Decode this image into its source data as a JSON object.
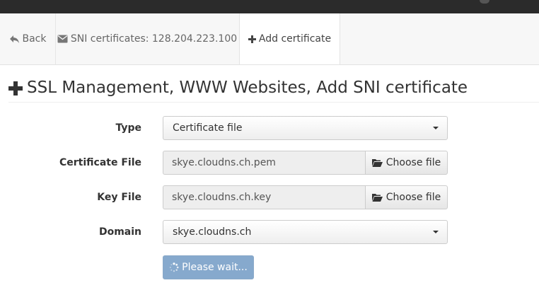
{
  "tabs": {
    "back": {
      "label": "Back",
      "icon": "reply-icon"
    },
    "sni": {
      "label": "SNI certificates: 128.204.223.100",
      "icon": "envelope-icon"
    },
    "add": {
      "label": "Add certificate",
      "icon": "plus-icon"
    }
  },
  "heading": {
    "icon": "plus-icon",
    "title": "SSL Management, WWW Websites, Add SNI certificate"
  },
  "form": {
    "type": {
      "label": "Type",
      "value": "Certificate file"
    },
    "certificate_file": {
      "label": "Certificate File",
      "value": "skye.cloudns.ch.pem",
      "button": "Choose file"
    },
    "key_file": {
      "label": "Key File",
      "value": "skye.cloudns.ch.key",
      "button": "Choose file"
    },
    "domain": {
      "label": "Domain",
      "value": "skye.cloudns.ch"
    },
    "submit": {
      "label": "Please wait...",
      "icon": "spinner-icon"
    }
  },
  "colors": {
    "topbar": "#2b2b2b",
    "tabbar": "#f7f7f7",
    "submit_button": "#86a9cd"
  }
}
